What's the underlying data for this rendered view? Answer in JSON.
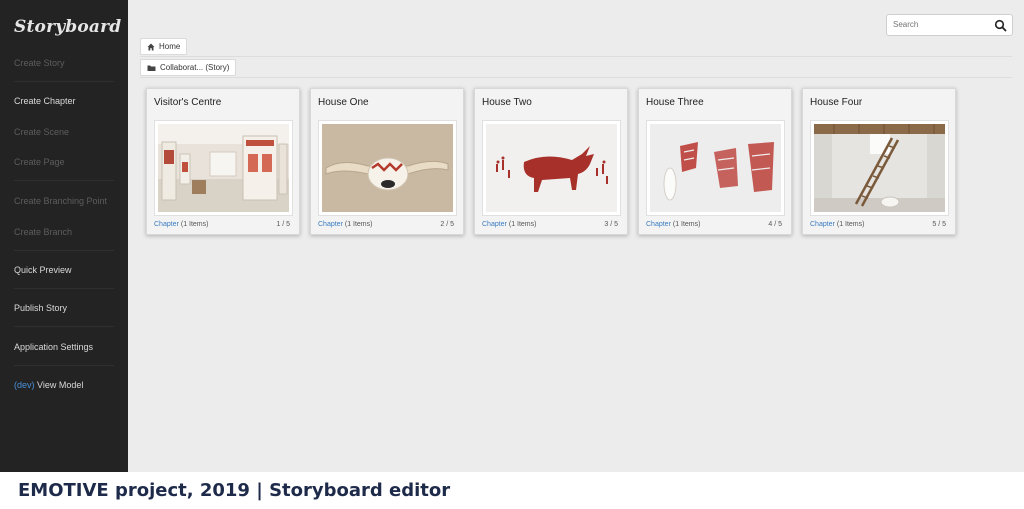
{
  "sidebar": {
    "logo": "Storyboard",
    "items": [
      {
        "label": "Create Story",
        "enabled": false
      },
      {
        "label": "Create Chapter",
        "enabled": true
      },
      {
        "label": "Create Scene",
        "enabled": false
      },
      {
        "label": "Create Page",
        "enabled": false
      },
      {
        "label": "Create Branching Point",
        "enabled": false
      },
      {
        "label": "Create Branch",
        "enabled": false
      },
      {
        "label": "Quick Preview",
        "enabled": true
      },
      {
        "label": "Publish Story",
        "enabled": true
      },
      {
        "label": "Application Settings",
        "enabled": true
      }
    ],
    "dev_item": {
      "prefix": "(dev)",
      "label": " View Model"
    }
  },
  "search": {
    "placeholder": "Search"
  },
  "breadcrumbs": [
    {
      "icon": "home-icon",
      "label": "Home"
    },
    {
      "icon": "folder-icon",
      "label": "Collaborat... (Story)"
    }
  ],
  "cards": [
    {
      "title": "Visitor's Centre",
      "link": "Chapter",
      "items": "(1 Items)",
      "page": "1 / 5",
      "image": "gallery-room"
    },
    {
      "title": "House One",
      "link": "Chapter",
      "items": "(1 Items)",
      "page": "2 / 5",
      "image": "horns-artifact"
    },
    {
      "title": "House Two",
      "link": "Chapter",
      "items": "(1 Items)",
      "page": "3 / 5",
      "image": "bull-mural"
    },
    {
      "title": "House Three",
      "link": "Chapter",
      "items": "(1 Items)",
      "page": "4 / 5",
      "image": "red-wall-paintings"
    },
    {
      "title": "House Four",
      "link": "Chapter",
      "items": "(1 Items)",
      "page": "5 / 5",
      "image": "ladder-room"
    }
  ],
  "caption": "EMOTIVE project, 2019 | Storyboard editor",
  "colors": {
    "sidebar": "#232323",
    "main": "#ececec",
    "link": "#3a7cc0",
    "caption": "#1e2a4a"
  }
}
